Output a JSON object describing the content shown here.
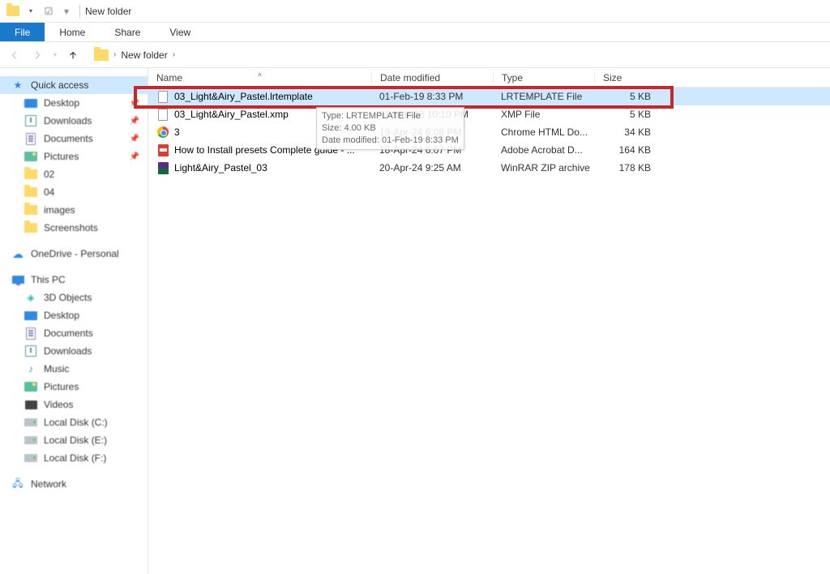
{
  "window": {
    "title": "New folder"
  },
  "ribbon": {
    "file": "File",
    "tabs": [
      "Home",
      "Share",
      "View"
    ]
  },
  "breadcrumb": {
    "folder": "New folder"
  },
  "sidebar": {
    "quick_access": "Quick access",
    "quick_items": [
      {
        "label": "Desktop",
        "icon": "desktop",
        "pinned": true
      },
      {
        "label": "Downloads",
        "icon": "downloads",
        "pinned": true
      },
      {
        "label": "Documents",
        "icon": "documents",
        "pinned": true
      },
      {
        "label": "Pictures",
        "icon": "pictures",
        "pinned": true
      },
      {
        "label": "02",
        "icon": "folder",
        "pinned": false
      },
      {
        "label": "04",
        "icon": "folder",
        "pinned": false
      },
      {
        "label": "images",
        "icon": "folder",
        "pinned": false
      },
      {
        "label": "Screenshots",
        "icon": "folder",
        "pinned": false
      }
    ],
    "onedrive": "OneDrive - Personal",
    "this_pc": "This PC",
    "pc_items": [
      {
        "label": "3D Objects",
        "icon": "3d"
      },
      {
        "label": "Desktop",
        "icon": "desktop"
      },
      {
        "label": "Documents",
        "icon": "documents"
      },
      {
        "label": "Downloads",
        "icon": "downloads"
      },
      {
        "label": "Music",
        "icon": "music"
      },
      {
        "label": "Pictures",
        "icon": "pictures"
      },
      {
        "label": "Videos",
        "icon": "videos"
      },
      {
        "label": "Local Disk (C:)",
        "icon": "drive"
      },
      {
        "label": "Local Disk (E:)",
        "icon": "drive"
      },
      {
        "label": "Local Disk (F:)",
        "icon": "drive"
      }
    ],
    "network": "Network"
  },
  "columns": {
    "name": "Name",
    "date": "Date modified",
    "type": "Type",
    "size": "Size"
  },
  "files": [
    {
      "name": "03_Light&Airy_Pastel.lrtemplate",
      "date": "01-Feb-19 8:33 PM",
      "type": "LRTEMPLATE File",
      "size": "5 KB",
      "icon": "blank",
      "selected": true
    },
    {
      "name": "03_Light&Airy_Pastel.xmp",
      "date": "07-Mar-18 10:10 PM",
      "type": "XMP File",
      "size": "5 KB",
      "icon": "blank",
      "selected": false
    },
    {
      "name": "3",
      "date": "19-Apr-24 6:08 PM",
      "type": "Chrome HTML Do...",
      "size": "34 KB",
      "icon": "chrome",
      "selected": false
    },
    {
      "name": "How to Install presets Complete guide - ...",
      "date": "18-Apr-24 6:07 PM",
      "type": "Adobe Acrobat D...",
      "size": "164 KB",
      "icon": "pdf",
      "selected": false
    },
    {
      "name": "Light&Airy_Pastel_03",
      "date": "20-Apr-24 9:25 AM",
      "type": "WinRAR ZIP archive",
      "size": "178 KB",
      "icon": "rar",
      "selected": false
    }
  ],
  "tooltip": {
    "line1": "Type: LRTEMPLATE File",
    "line2": "Size: 4.00 KB",
    "line3": "Date modified: 01-Feb-19 8:33 PM"
  }
}
